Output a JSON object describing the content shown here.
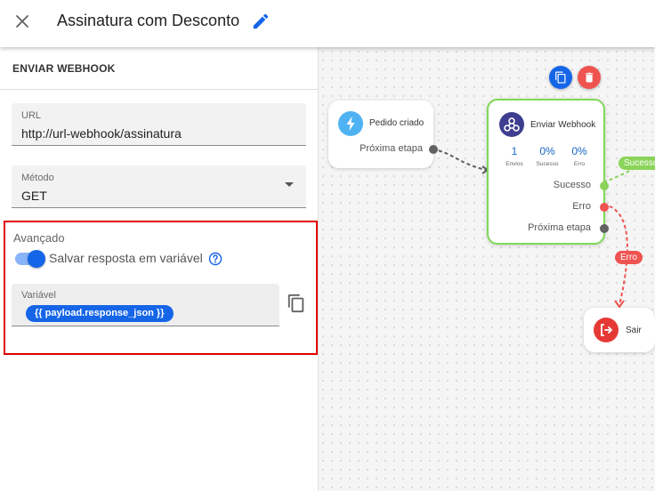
{
  "header": {
    "title": "Assinatura com Desconto"
  },
  "panel": {
    "section_title": "ENVIAR WEBHOOK",
    "url": {
      "label": "URL",
      "value": "http://url-webhook/assinatura"
    },
    "method": {
      "label": "Método",
      "value": "GET"
    },
    "advanced": {
      "title": "Avançado",
      "toggle_label": "Salvar resposta em variável",
      "toggle_on": true,
      "variable": {
        "label": "Variável",
        "chip": "{{ payload.response_json }}"
      }
    }
  },
  "flow": {
    "trigger": {
      "title": "Pedido criado",
      "port_label": "Próxima etapa",
      "icon": "bolt-icon"
    },
    "webhook": {
      "title": "Enviar Webhook",
      "icon": "webhook-icon",
      "stats": [
        {
          "value": "1",
          "label": "Envios"
        },
        {
          "value": "0%",
          "label": "Sucesso"
        },
        {
          "value": "0%",
          "label": "Erro"
        }
      ],
      "ports": {
        "success": "Sucesso",
        "error": "Erro",
        "next": "Próxima etapa"
      }
    },
    "exit": {
      "title": "Sair",
      "icon": "exit-icon"
    },
    "edges": {
      "success_label": "Sucesso",
      "error_label": "Erro"
    }
  },
  "colors": {
    "accent": "#1565e8",
    "success": "#7ed957",
    "danger": "#ef5350",
    "highlight": "#e00000"
  }
}
